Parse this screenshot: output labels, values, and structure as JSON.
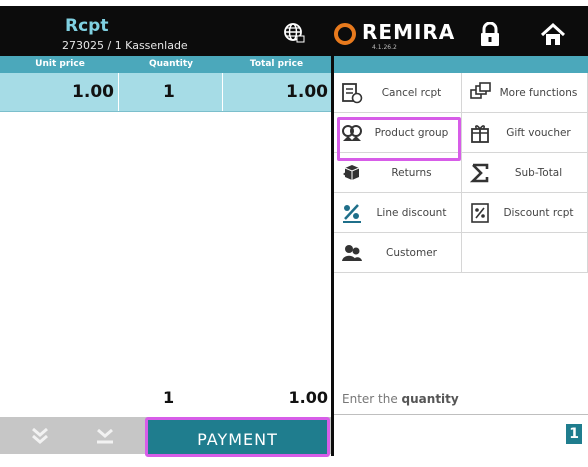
{
  "header": {
    "title": "Rcpt",
    "subtitle": "273025 / 1 Kassenlade",
    "brand": "REMIRA",
    "version": "4.1.26.2"
  },
  "table": {
    "columns": [
      "Unit price",
      "Quantity",
      "Total price"
    ],
    "rows": [
      {
        "unit_price": "1.00",
        "quantity": "1",
        "total_price": "1.00"
      }
    ],
    "totals": {
      "quantity": "1",
      "total_price": "1.00"
    }
  },
  "footer": {
    "payment_label": "PAYMENT"
  },
  "functions": [
    {
      "label": "Cancel rcpt",
      "icon": "cancel-receipt-icon"
    },
    {
      "label": "More functions",
      "icon": "more-functions-icon"
    },
    {
      "label": "Product group",
      "icon": "product-group-icon"
    },
    {
      "label": "Gift voucher",
      "icon": "gift-voucher-icon"
    },
    {
      "label": "Returns",
      "icon": "returns-icon"
    },
    {
      "label": "Sub-Total",
      "icon": "sigma-icon"
    },
    {
      "label": "Line discount",
      "icon": "percent-icon"
    },
    {
      "label": "Discount rcpt",
      "icon": "discount-receipt-icon"
    },
    {
      "label": "Customer",
      "icon": "customer-icon"
    }
  ],
  "prompt": {
    "prefix": "Enter the",
    "emphasis": "quantity"
  },
  "input": {
    "value": "1"
  },
  "colors": {
    "accent": "#4ba8bb",
    "row_selected": "#a6dce6",
    "payment": "#1f7d8e",
    "highlight": "#d75de8",
    "logo_orange": "#e87a1d"
  }
}
